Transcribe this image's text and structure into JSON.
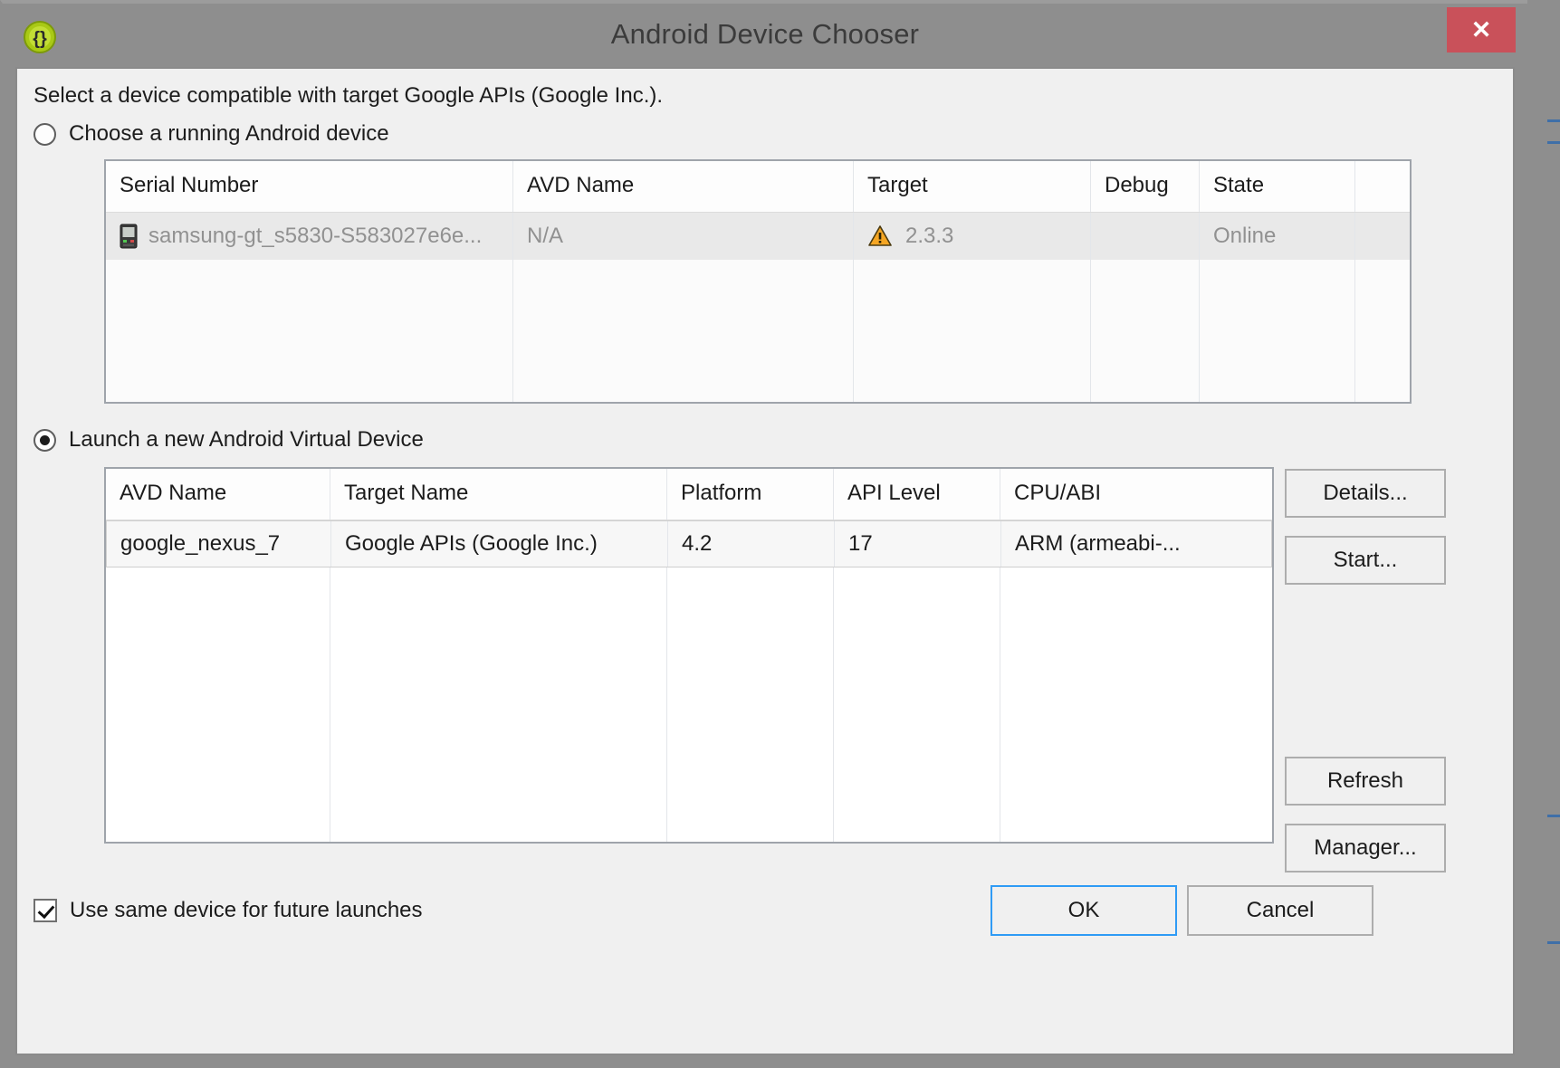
{
  "window": {
    "title": "Android Device Chooser",
    "icon": "braces-icon",
    "close_label": "✕",
    "accent_close": "#c9515a",
    "focus_border": "#2f9bf5"
  },
  "dialog": {
    "intro": "Select a device compatible with target Google APIs (Google Inc.)."
  },
  "running_device_section": {
    "radio_label": "Choose a running Android device",
    "radio_selected": false,
    "columns": [
      "Serial Number",
      "AVD Name",
      "Target",
      "Debug",
      "State"
    ],
    "rows": [
      {
        "serial": "samsung-gt_s5830-S583027e6e...",
        "serial_icon": "phone-icon",
        "avd_name": "N/A",
        "target": "2.3.3",
        "target_icon": "warning-icon",
        "debug": "",
        "state": "Online"
      }
    ]
  },
  "avd_section": {
    "radio_label": "Launch a new Android Virtual Device",
    "radio_selected": true,
    "columns": [
      "AVD Name",
      "Target Name",
      "Platform",
      "API Level",
      "CPU/ABI"
    ],
    "rows": [
      {
        "avd_name": "google_nexus_7",
        "target_name": "Google APIs (Google Inc.)",
        "platform": "4.2",
        "api_level": "17",
        "cpu_abi": "ARM (armeabi-..."
      }
    ],
    "buttons": {
      "details": "Details...",
      "start": "Start...",
      "refresh": "Refresh",
      "manager": "Manager..."
    }
  },
  "footer": {
    "checkbox_label": "Use same device for future launches",
    "checkbox_checked": true,
    "ok": "OK",
    "cancel": "Cancel"
  }
}
